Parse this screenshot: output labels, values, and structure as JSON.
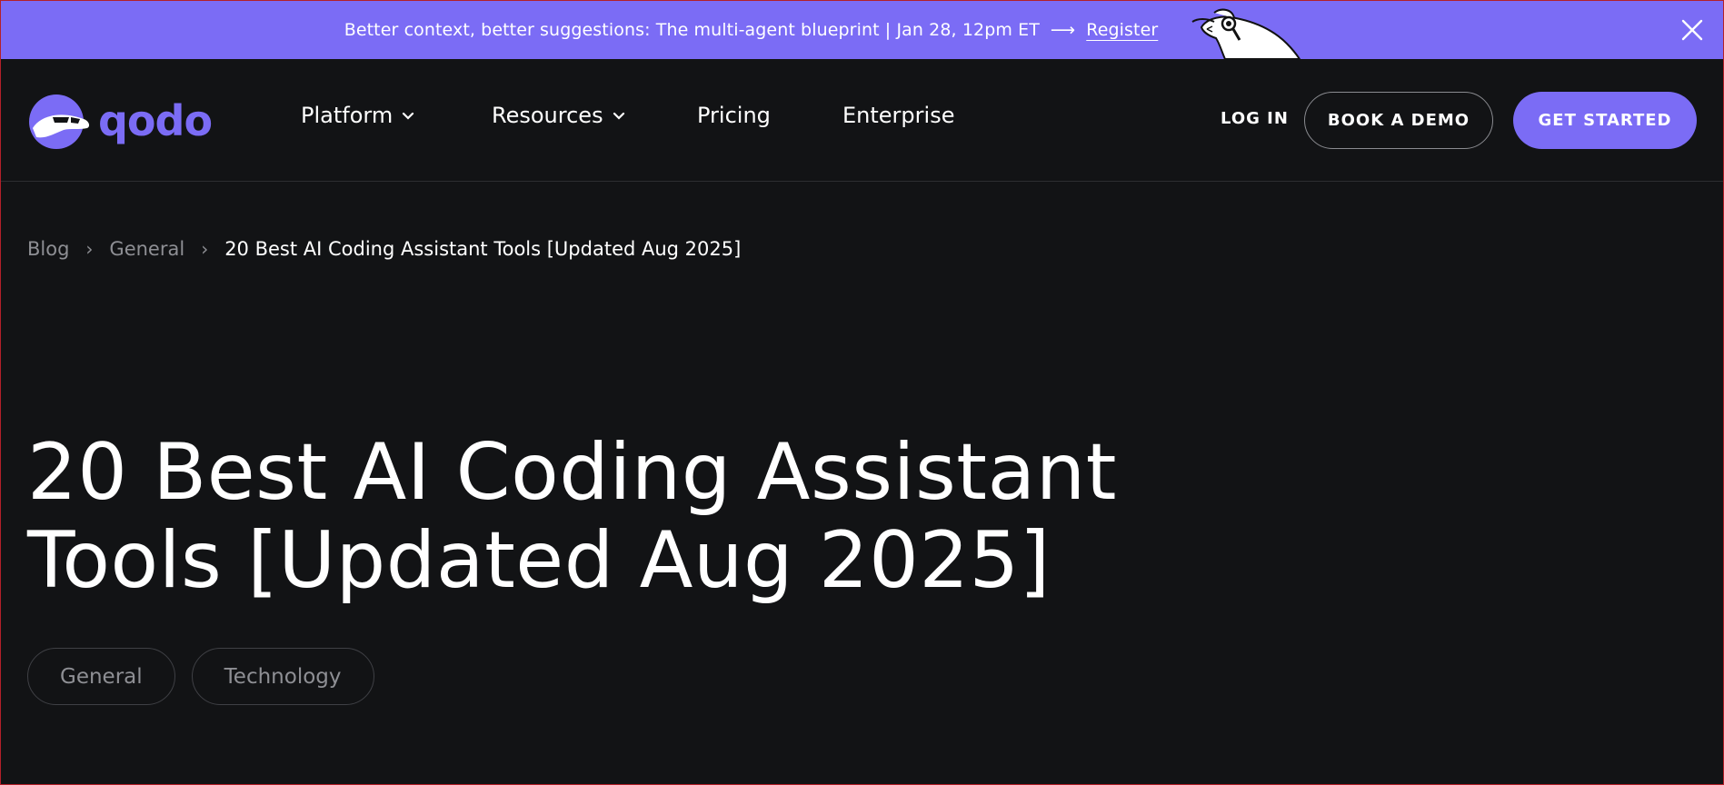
{
  "banner": {
    "text": "Better context, better suggestions: The multi-agent blueprint | Jan 28, 12pm ET",
    "arrow": "⟶",
    "link_label": "Register",
    "mascot_icon": "anteater-detective-icon",
    "close_icon": "close-icon"
  },
  "nav": {
    "logo_text": "qodo",
    "items": [
      {
        "label": "Platform",
        "has_dropdown": true
      },
      {
        "label": "Resources",
        "has_dropdown": true
      },
      {
        "label": "Pricing",
        "has_dropdown": false
      },
      {
        "label": "Enterprise",
        "has_dropdown": false
      }
    ],
    "login_label": "LOG IN",
    "demo_label": "BOOK A DEMO",
    "start_label": "GET STARTED"
  },
  "breadcrumb": {
    "items": [
      "Blog",
      "General"
    ],
    "separator": "›",
    "current": "20 Best AI Coding Assistant Tools [Updated Aug 2025]"
  },
  "article": {
    "title_line1": "20 Best AI Coding Assistant",
    "title_line2": "Tools [Updated Aug 2025]",
    "tags": [
      "General",
      "Technology"
    ]
  },
  "colors": {
    "accent": "#7b6cf5",
    "background": "#121315",
    "muted_text": "#8e8f94"
  }
}
